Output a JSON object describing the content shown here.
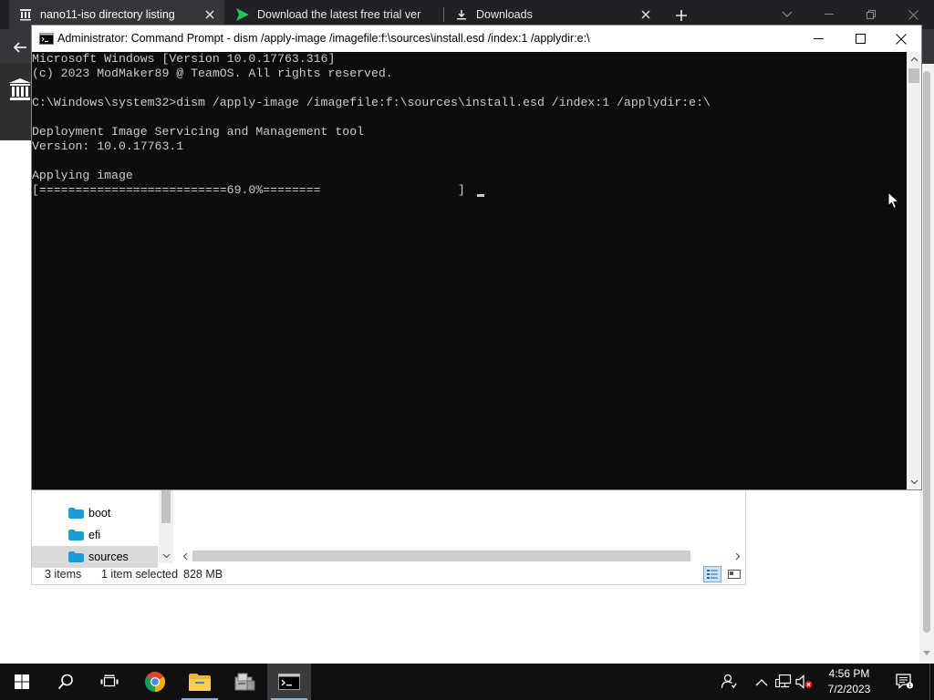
{
  "browser": {
    "tabs": [
      {
        "title": "nano11-iso directory listing",
        "icon": "archive-icon",
        "active": true
      },
      {
        "title": "Download the latest free trial ver",
        "icon": "arrow-logo-icon",
        "active": false
      },
      {
        "title": "Downloads",
        "icon": "download-icon",
        "active": false
      }
    ],
    "new_tab_icon": "plus-icon",
    "colors": {
      "tabstrip": "#202124",
      "active_tab": "#35363a"
    }
  },
  "cmd": {
    "title": "Administrator: Command Prompt - dism  /apply-image /imagefile:f:\\sources\\install.esd /index:1 /applydir:e:\\",
    "lines": [
      "Microsoft Windows [Version 10.0.17763.316]",
      "(c) 2023 ModMaker89 @ TeamOS. All rights reserved.",
      "",
      "C:\\Windows\\system32>dism /apply-image /imagefile:f:\\sources\\install.esd /index:1 /applydir:e:\\",
      "",
      "Deployment Image Servicing and Management tool",
      "Version: 10.0.17763.1",
      "",
      "Applying image",
      "[==========================69.0%========                   ]"
    ],
    "progress_percent": 69.0,
    "colors": {
      "background": "#0c0c0c",
      "text": "#cccccc"
    }
  },
  "explorer": {
    "folders": [
      {
        "name": "boot",
        "selected": false
      },
      {
        "name": "efi",
        "selected": false
      },
      {
        "name": "sources",
        "selected": true
      }
    ],
    "status": {
      "items": "3 items",
      "selected": "1 item selected",
      "size": "828 MB"
    },
    "folder_color": "#1e9ad6"
  },
  "taskbar": {
    "apps": [
      "windows-start-icon",
      "search-icon",
      "task-view-icon",
      "chrome-icon",
      "file-explorer-icon",
      "installer-icon",
      "command-prompt-icon"
    ],
    "tray": [
      "people-icon",
      "chevron-up-icon",
      "network-icon",
      "volume-muted-icon",
      "notification-icon"
    ],
    "clock": {
      "time": "4:56 PM",
      "date": "7/2/2023"
    },
    "colors": {
      "background": "#101010",
      "accent": "#76b9ed"
    }
  }
}
